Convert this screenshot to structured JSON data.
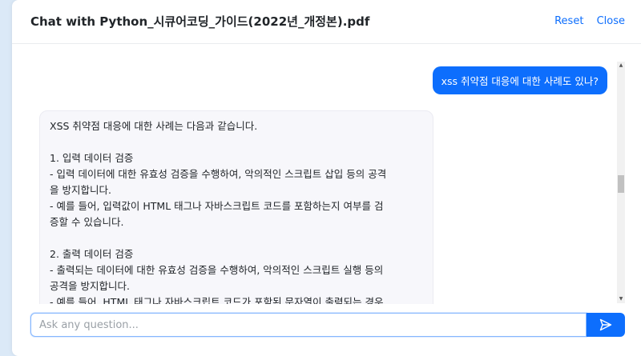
{
  "header": {
    "title": "Chat with Python_시큐어코딩_가이드(2022년_개정본).pdf",
    "reset_label": "Reset",
    "close_label": "Close"
  },
  "conversation": {
    "user_message": "xss 취약점 대응에 대한 사례도 있나?",
    "bot_lines": [
      "XSS 취약점 대응에 대한 사례는 다음과 같습니다.",
      "",
      "1. 입력 데이터 검증",
      "- 입력 데이터에 대한 유효성 검증을 수행하여, 악의적인 스크립트 삽입 등의 공격",
      "을 방지합니다.",
      "- 예를 들어, 입력값이 HTML 태그나 자바스크립트 코드를 포함하는지 여부를 검",
      "증할 수 있습니다.",
      "",
      "2. 출력 데이터 검증",
      "- 출력되는 데이터에 대한 유효성 검증을 수행하여, 악의적인 스크립트 실행 등의",
      "공격을 방지합니다.",
      "- 예를 들어, HTML 태그나 자바스크립트 코드가 포함된 문자열이 출력되는 경우"
    ]
  },
  "input": {
    "placeholder": "Ask any question...",
    "value": ""
  },
  "icons": {
    "send": "send-icon",
    "scroll_up": "scroll-up-arrow-icon",
    "scroll_down": "scroll-down-arrow-icon"
  },
  "colors": {
    "accent": "#0d6efd",
    "bot_bubble_bg": "#f7f7fb",
    "page_bg": "#dbe9f7"
  }
}
